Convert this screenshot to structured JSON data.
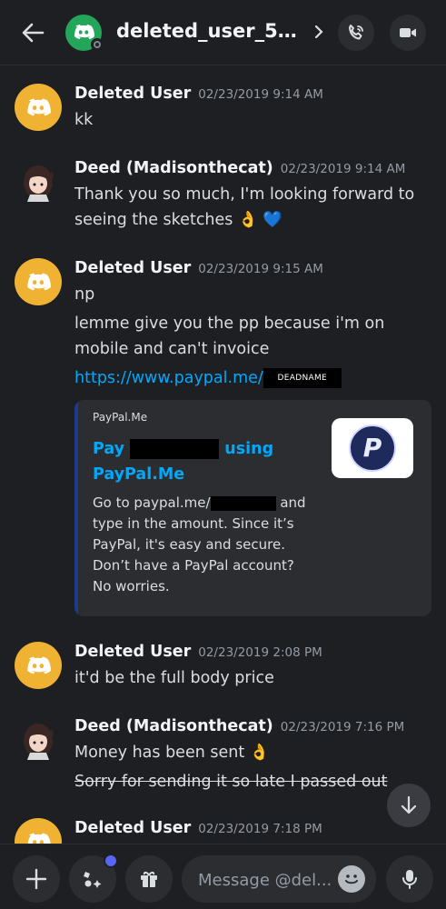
{
  "header": {
    "title": "deleted_user_5ce...",
    "accent": "#23a55a"
  },
  "messages": [
    {
      "author": "Deleted User",
      "time": "02/23/2019 9:14 AM",
      "lines": [
        "kk"
      ]
    },
    {
      "author": "Deed (Madisonthecat)",
      "time": "02/23/2019 9:14 AM",
      "lines": [
        "Thank you so much, I'm looking forward to seeing the sketches 👌 💙"
      ]
    },
    {
      "author": "Deleted User",
      "time": "02/23/2019 9:15 AM",
      "lines": [
        "np",
        "lemme give you the pp because i'm on mobile and can't invoice"
      ],
      "link": "https://www.paypal.me/",
      "link_redaction": "DEADNAME"
    },
    {
      "author": "Deleted User",
      "time": "02/23/2019 2:08 PM",
      "lines": [
        "it'd be the full body price"
      ]
    },
    {
      "author": "Deed (Madisonthecat)",
      "time": "02/23/2019 7:16 PM",
      "lines": [
        "Money has been sent 👌",
        "Sorry for sending it so late I passed out"
      ]
    },
    {
      "author": "Deleted User",
      "time": "02/23/2019 7:18 PM",
      "lines": []
    }
  ],
  "embed": {
    "provider": "PayPal.Me",
    "title_start": "Pay",
    "title_end": "using",
    "title_line2": "PayPal.Me",
    "desc_start": "Go to paypal.me/",
    "desc_rest": "and type in the amount. Since it’s PayPal, it's easy and secure. Don’t have a PayPal account? No worries.",
    "thumb_letter": "P"
  },
  "composer": {
    "placeholder": "Message @del..."
  }
}
